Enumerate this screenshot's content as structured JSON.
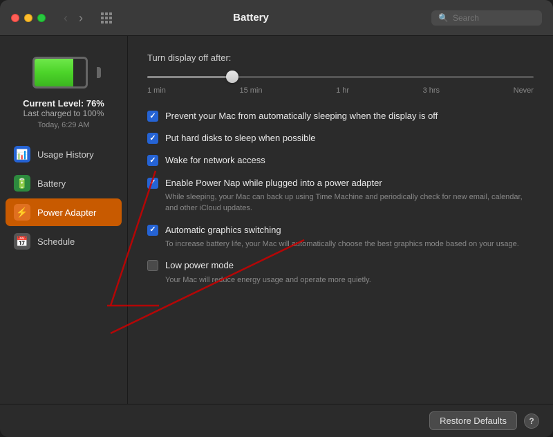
{
  "titlebar": {
    "title": "Battery",
    "search_placeholder": "Search"
  },
  "sidebar": {
    "battery_level": "Current Level: 76%",
    "battery_charged": "Last charged to 100%",
    "battery_time": "Today, 6:29 AM",
    "nav_items": [
      {
        "id": "usage-history",
        "label": "Usage History",
        "icon": "📊",
        "icon_class": "icon-blue",
        "active": false
      },
      {
        "id": "battery",
        "label": "Battery",
        "icon": "🔋",
        "icon_class": "icon-green",
        "active": false
      },
      {
        "id": "power-adapter",
        "label": "Power Adapter",
        "icon": "⚡",
        "icon_class": "icon-orange",
        "active": true
      },
      {
        "id": "schedule",
        "label": "Schedule",
        "icon": "📅",
        "icon_class": "icon-gray",
        "active": false
      }
    ]
  },
  "content": {
    "slider_label": "Turn display off after:",
    "slider_ticks": [
      "1 min",
      "15 min",
      "1 hr",
      "3 hrs",
      "Never"
    ],
    "options": [
      {
        "id": "prevent-sleep",
        "label": "Prevent your Mac from automatically sleeping when the display is off",
        "desc": "",
        "checked": true
      },
      {
        "id": "hard-disk-sleep",
        "label": "Put hard disks to sleep when possible",
        "desc": "",
        "checked": true
      },
      {
        "id": "wake-network",
        "label": "Wake for network access",
        "desc": "",
        "checked": true
      },
      {
        "id": "power-nap",
        "label": "Enable Power Nap while plugged into a power adapter",
        "desc": "While sleeping, your Mac can back up using Time Machine and periodically check for new email, calendar, and other iCloud updates.",
        "checked": true
      },
      {
        "id": "auto-graphics",
        "label": "Automatic graphics switching",
        "desc": "To increase battery life, your Mac will automatically choose the best graphics mode based on your usage.",
        "checked": true
      },
      {
        "id": "low-power",
        "label": "Low power mode",
        "desc": "Your Mac will reduce energy usage and operate more quietly.",
        "checked": false
      }
    ],
    "restore_defaults_label": "Restore Defaults",
    "help_label": "?"
  }
}
